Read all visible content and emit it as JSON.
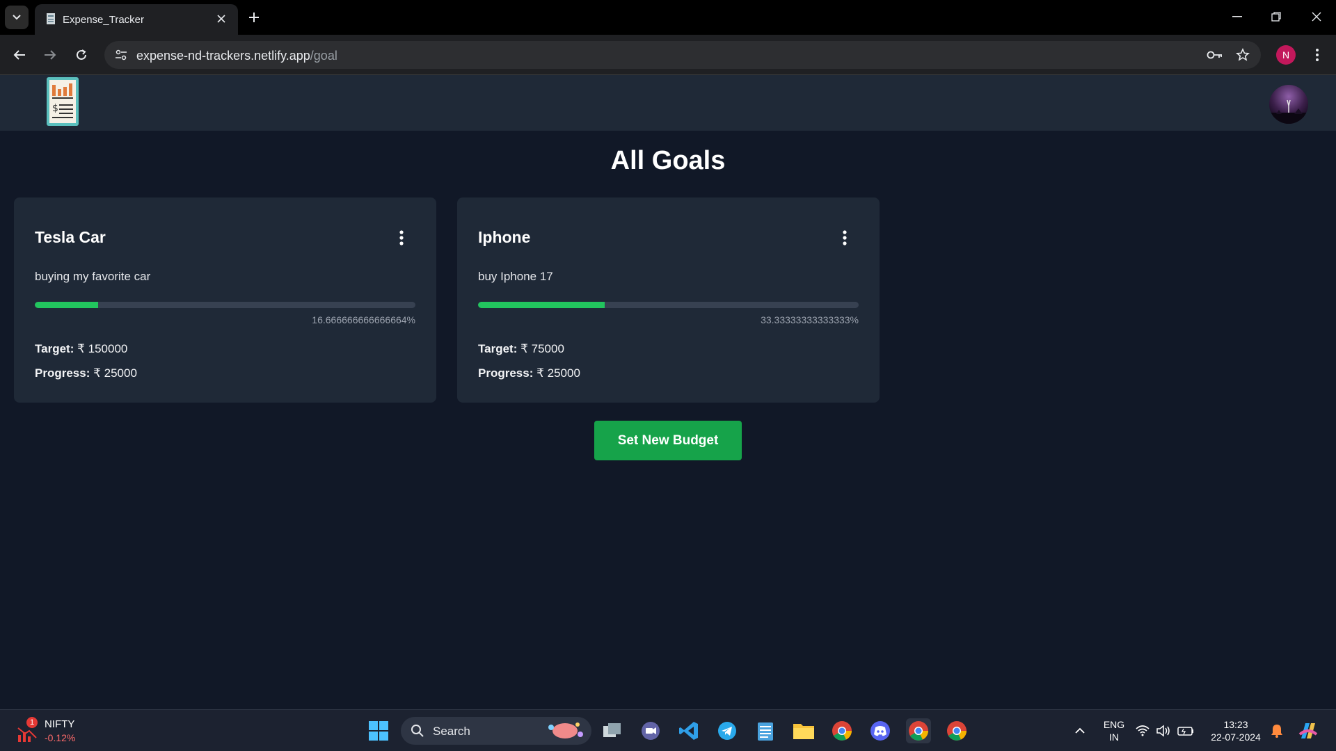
{
  "browser": {
    "tab_title": "Expense_Tracker",
    "url_host": "expense-nd-trackers.netlify.app",
    "url_path": "/goal",
    "profile_initial": "N"
  },
  "page": {
    "title": "All Goals",
    "set_budget_label": "Set New Budget"
  },
  "goals": [
    {
      "name": "Tesla Car",
      "description": "buying my favorite car",
      "percent_text": "16.666666666666664%",
      "percent": 16.67,
      "target_label": "Target:",
      "target_value": "₹ 150000",
      "progress_label": "Progress:",
      "progress_value": "₹ 25000"
    },
    {
      "name": "Iphone",
      "description": "buy Iphone 17",
      "percent_text": "33.33333333333333%",
      "percent": 33.33,
      "target_label": "Target:",
      "target_value": "₹ 75000",
      "progress_label": "Progress:",
      "progress_value": "₹ 25000"
    }
  ],
  "taskbar": {
    "nifty_label": "NIFTY",
    "nifty_change": "-0.12%",
    "nifty_badge": "1",
    "search_label": "Search",
    "lang_top": "ENG",
    "lang_bottom": "IN",
    "time": "13:23",
    "date": "22-07-2024"
  },
  "colors": {
    "accent": "#22c55e",
    "button": "#16a34a",
    "card_bg": "#1f2937",
    "page_bg": "#111827"
  }
}
